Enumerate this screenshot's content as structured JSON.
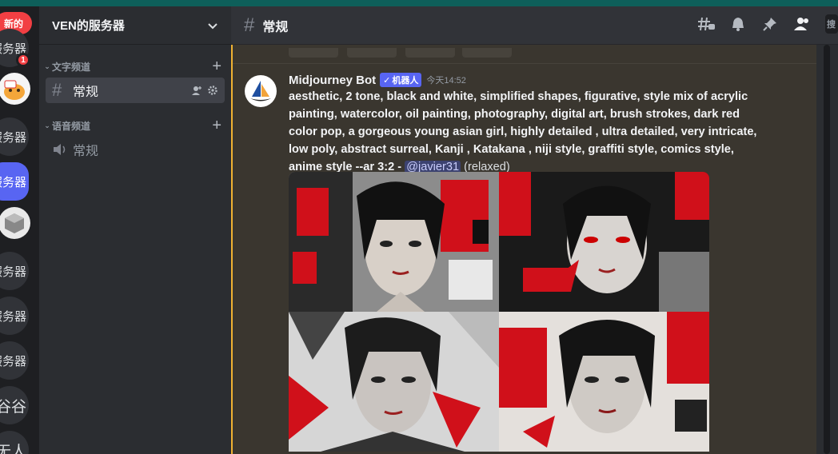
{
  "rail": {
    "new_pill": "新的",
    "servers": [
      {
        "label": "的服务器"
      },
      {
        "label": "的服务器"
      },
      {
        "label": "的服务器"
      },
      {
        "label": "的服务器"
      },
      {
        "label": "的服务器"
      },
      {
        "label": "的服务器"
      },
      {
        "label": "谷谷"
      },
      {
        "label": "无人"
      }
    ],
    "badge_count": "1"
  },
  "sidebar": {
    "server_name": "VEN的服务器",
    "text_category": "文字频道",
    "text_channel": "常规",
    "voice_category": "语音频道",
    "voice_channel": "常规"
  },
  "header": {
    "channel_name": "常规",
    "search_stub": "搜"
  },
  "message": {
    "author": "Midjourney Bot",
    "bot_tag": "机器人",
    "bot_check": "✓",
    "timestamp": "今天14:52",
    "prompt": "aesthetic, 2 tone, black and white, simplified shapes, figurative, style mix of acrylic painting, watercolor, oil painting, photography, digital art, brush strokes, dark red color pop, a gorgeous young asian girl, highly detailed , ultra detailed, very intricate, low poly, abstract surreal, Kanji , Katakana , niji style, graffiti style, comics style, anime style --ar 3:2 - ",
    "mention": "@javier31",
    "mode": "(relaxed)"
  },
  "colors": {
    "accent": "#5865f2",
    "alert": "#f23f43",
    "art_red": "#d0101a"
  }
}
